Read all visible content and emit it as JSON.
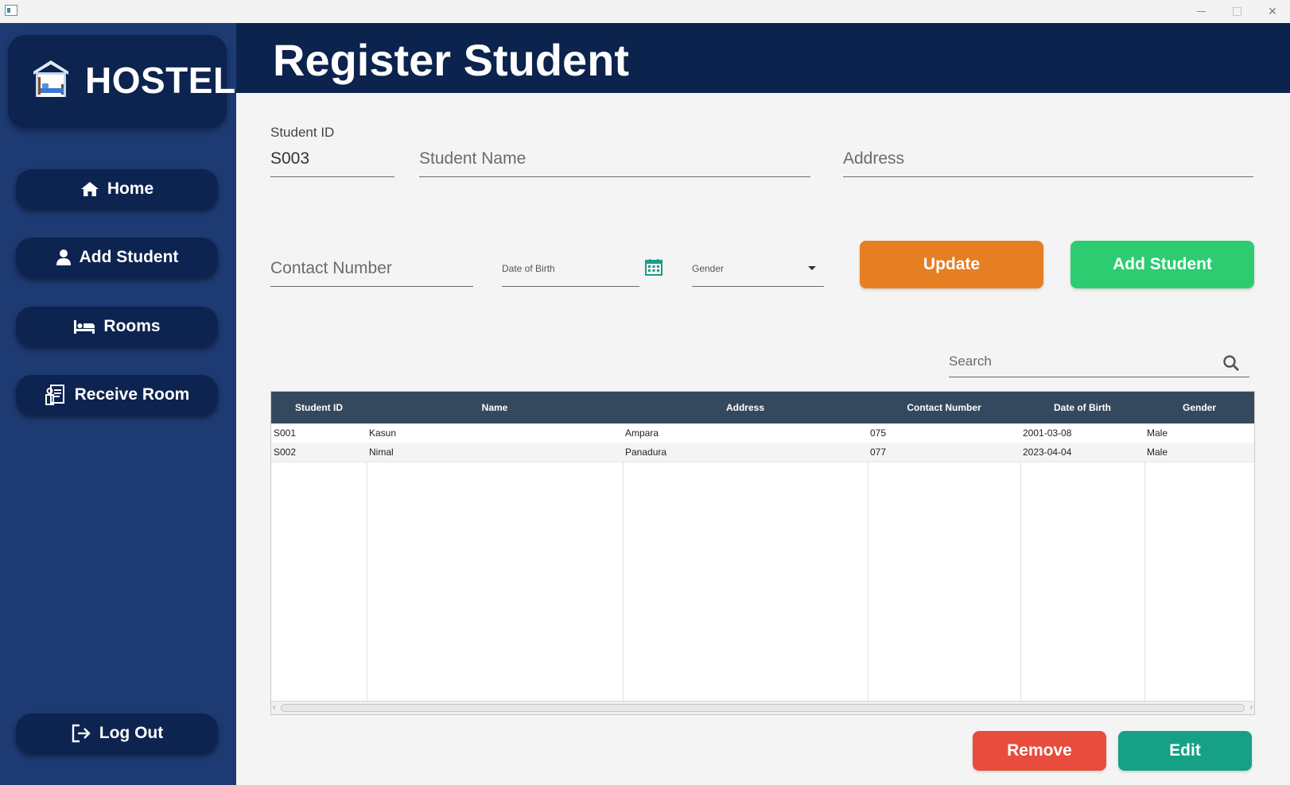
{
  "window": {
    "minimize_label": "—",
    "maximize_label": "□",
    "close_label": "✕"
  },
  "sidebar": {
    "logo_text": "HOSTEL",
    "logo_icon": "hostel-house-icon",
    "items": [
      {
        "label": "Home",
        "icon": "home-icon"
      },
      {
        "label": "Add Student",
        "icon": "user-icon"
      },
      {
        "label": "Rooms",
        "icon": "bed-icon"
      },
      {
        "label": "Receive Room",
        "icon": "receipt-icon"
      }
    ],
    "logout_label": "Log Out"
  },
  "header": {
    "title": "Register Student"
  },
  "form": {
    "student_id_label": "Student ID",
    "student_id_value": "S003",
    "student_name_placeholder": "Student Name",
    "address_placeholder": "Address",
    "contact_placeholder": "Contact Number",
    "dob_placeholder": "Date of Birth",
    "gender_placeholder": "Gender",
    "update_label": "Update",
    "add_student_label": "Add Student"
  },
  "search": {
    "placeholder": "Search"
  },
  "table": {
    "columns": [
      "Student ID",
      "Name",
      "Address",
      "Contact Number",
      "Date of Birth",
      "Gender"
    ],
    "rows": [
      [
        "S001",
        "Kasun",
        "Ampara",
        "075",
        "2001-03-08",
        "Male"
      ],
      [
        "S002",
        "Nimal",
        "Panadura",
        "077",
        "2023-04-04",
        "Male"
      ]
    ]
  },
  "actions": {
    "remove_label": "Remove",
    "edit_label": "Edit"
  },
  "colors": {
    "sidebar_bg": "#1d3a73",
    "header_bg": "#0b234d",
    "update": "#e67e22",
    "add": "#2ecc71",
    "remove": "#e74c3c",
    "edit": "#16a085",
    "table_header": "#34495e"
  }
}
